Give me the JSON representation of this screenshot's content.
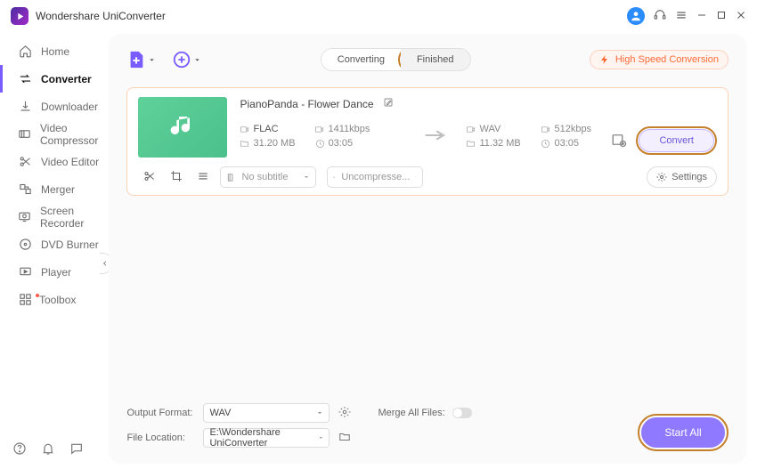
{
  "app_title": "Wondershare UniConverter",
  "sidebar": {
    "items": [
      {
        "label": "Home"
      },
      {
        "label": "Converter"
      },
      {
        "label": "Downloader"
      },
      {
        "label": "Video Compressor"
      },
      {
        "label": "Video Editor"
      },
      {
        "label": "Merger"
      },
      {
        "label": "Screen Recorder"
      },
      {
        "label": "DVD Burner"
      },
      {
        "label": "Player"
      },
      {
        "label": "Toolbox"
      }
    ]
  },
  "tabs": {
    "converting": "Converting",
    "finished": "Finished"
  },
  "high_speed_label": "High Speed Conversion",
  "file": {
    "name": "PianoPanda - Flower Dance",
    "source": {
      "format": "FLAC",
      "bitrate": "1411kbps",
      "size": "31.20 MB",
      "duration": "03:05"
    },
    "target": {
      "format": "WAV",
      "bitrate": "512kbps",
      "size": "11.32 MB",
      "duration": "03:05"
    },
    "subtitle_dd": "No subtitle",
    "audio_dd": "Uncompresse...",
    "settings_label": "Settings",
    "convert_label": "Convert"
  },
  "bottom": {
    "output_format_label": "Output Format:",
    "output_format_value": "WAV",
    "file_location_label": "File Location:",
    "file_location_value": "E:\\Wondershare UniConverter",
    "merge_label": "Merge All Files:",
    "start_all_label": "Start All"
  }
}
